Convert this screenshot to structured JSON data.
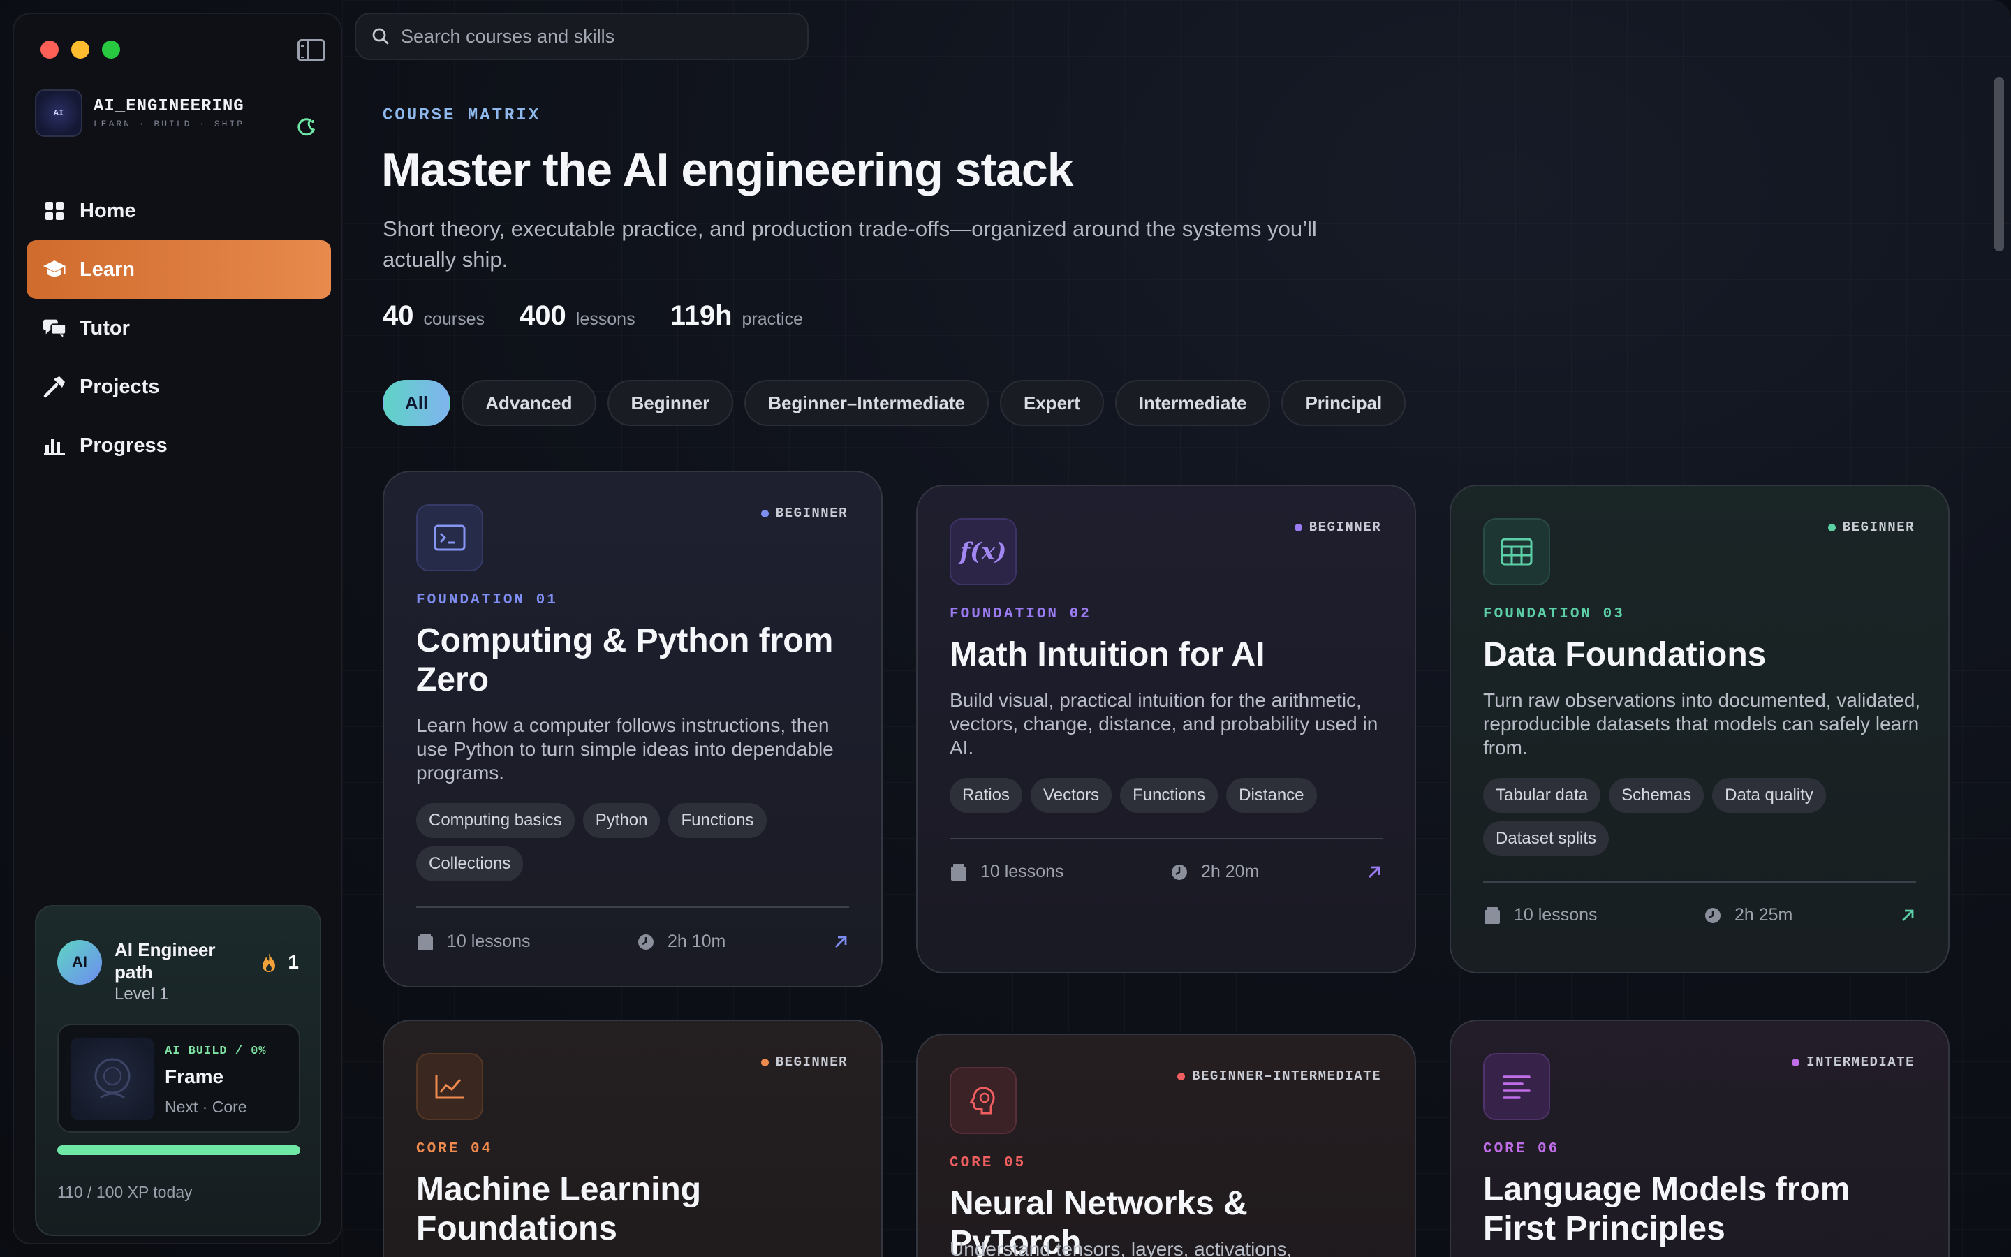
{
  "brand": {
    "name": "AI_ENGINEERING",
    "subtitle": "LEARN · BUILD · SHIP",
    "logo_text": "AI"
  },
  "search": {
    "placeholder": "Search courses and skills"
  },
  "nav": [
    {
      "label": "Home",
      "icon": "grid-icon"
    },
    {
      "label": "Learn",
      "icon": "graduation-cap-icon",
      "active": true
    },
    {
      "label": "Tutor",
      "icon": "chat-bubbles-icon"
    },
    {
      "label": "Projects",
      "icon": "hammer-icon"
    },
    {
      "label": "Progress",
      "icon": "bar-chart-icon"
    }
  ],
  "profile": {
    "avatar": "AI",
    "name": "AI Engineer path",
    "level": "Level 1",
    "streak": "1",
    "frame": {
      "tag": "AI BUILD / 0%",
      "title": "Frame",
      "subtitle": "Next · Core"
    },
    "xp_progress": 1.0,
    "xp_text": "110 / 100 XP today"
  },
  "header": {
    "eyebrow": "COURSE MATRIX",
    "title": "Master the AI engineering stack",
    "subtitle": "Short theory, executable practice, and production trade-offs—organized around the systems you’ll actually ship.",
    "stats": [
      {
        "num": "40",
        "label": "courses"
      },
      {
        "num": "400",
        "label": "lessons"
      },
      {
        "num": "119h",
        "label": "practice"
      }
    ]
  },
  "filters": [
    "All",
    "Advanced",
    "Beginner",
    "Beginner–Intermediate",
    "Expert",
    "Intermediate",
    "Principal"
  ],
  "colors": {
    "accent_orange": "#e0803f",
    "blue": "#7e8df0",
    "purple": "#9b7cf2",
    "teal": "#5ccfa6",
    "orange": "#ef8a4e",
    "red": "#ef5f5f",
    "magenta": "#c06ee8"
  },
  "courses": [
    {
      "code": "FOUNDATION 01",
      "level": "BEGINNER",
      "title": "Computing & Python from Zero",
      "desc": "Learn how a computer follows instructions, then use Python to turn simple ideas into dependable programs.",
      "tags": [
        "Computing basics",
        "Python",
        "Functions",
        "Collections"
      ],
      "lessons": "10 lessons",
      "duration": "2h 10m",
      "icon": "terminal-icon"
    },
    {
      "code": "FOUNDATION 02",
      "level": "BEGINNER",
      "title": "Math Intuition for AI",
      "desc": "Build visual, practical intuition for the arithmetic, vectors, change, distance, and probability used in AI.",
      "tags": [
        "Ratios",
        "Vectors",
        "Functions",
        "Distance"
      ],
      "lessons": "10 lessons",
      "duration": "2h 20m",
      "icon": "function-icon",
      "icon_text": "f(x)"
    },
    {
      "code": "FOUNDATION 03",
      "level": "BEGINNER",
      "title": "Data Foundations",
      "desc": "Turn raw observations into documented, validated, reproducible datasets that models can safely learn from.",
      "tags": [
        "Tabular data",
        "Schemas",
        "Data quality",
        "Dataset splits"
      ],
      "lessons": "10 lessons",
      "duration": "2h 25m",
      "icon": "table-icon"
    },
    {
      "code": "CORE 04",
      "level": "BEGINNER",
      "title": "Machine Learning Foundations",
      "icon": "line-chart-icon"
    },
    {
      "code": "CORE 05",
      "level": "BEGINNER–INTERMEDIATE",
      "title": "Neural Networks & PyTorch",
      "desc": "Understand tensors, layers, activations,",
      "icon": "brain-icon"
    },
    {
      "code": "CORE 06",
      "level": "INTERMEDIATE",
      "title": "Language Models from First Principles",
      "icon": "text-lines-icon"
    }
  ]
}
